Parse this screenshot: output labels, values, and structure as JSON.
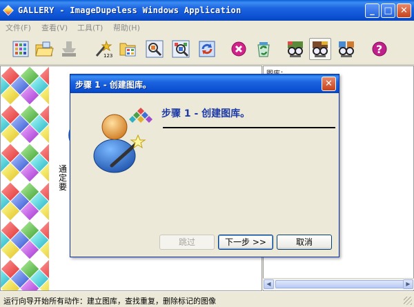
{
  "window": {
    "title": "GALLERY - ImageDupeless Windows Application",
    "min_label": "_",
    "max_label": "□",
    "close_label": "✕"
  },
  "menu": [
    "文件(F)",
    "查看(V)",
    "工具(T)",
    "帮助(H)"
  ],
  "toolbar": [
    {
      "icon": "gallery-grid-icon"
    },
    {
      "icon": "open-folder-icon"
    },
    {
      "icon": "disabled-stamp-icon"
    },
    {
      "icon": "wizard-123-icon"
    },
    {
      "icon": "folder-grid-icon"
    },
    {
      "icon": "magnify-image-icon"
    },
    {
      "icon": "magnify-grid-icon"
    },
    {
      "icon": "refresh-images-icon"
    },
    {
      "icon": "stop-icon"
    },
    {
      "icon": "recycle-icon"
    },
    {
      "icon": "viewer-glasses-icon"
    },
    {
      "icon": "compare-glasses-icon"
    },
    {
      "icon": "dual-compare-icon"
    },
    {
      "icon": "help-icon"
    }
  ],
  "left_pane": {
    "side_text": "通定要"
  },
  "right_pane": {
    "tree_header": "图库："
  },
  "dialog": {
    "title": "步骤 1 - 创建图库。",
    "heading": "步骤 1 - 创建图库。",
    "buttons": {
      "skip": "跳过",
      "next": "下一步 >>",
      "cancel": "取消"
    }
  },
  "status": {
    "text": "运行向导开始所有动作：建立图库，查找重复，删除标记的图像"
  },
  "colors": {
    "titlebar": "#0A4FD0",
    "face": "#ECE9D8",
    "heading": "#1D3AA6"
  }
}
